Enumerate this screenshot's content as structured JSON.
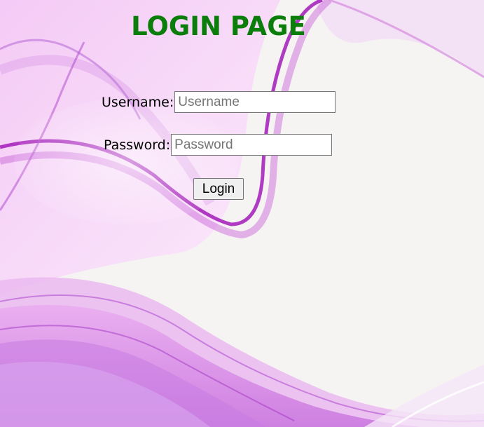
{
  "page": {
    "title": "LOGIN PAGE",
    "title_color": "#0b7d0b",
    "background_accent": "#c23fdc"
  },
  "form": {
    "username_label": "Username:",
    "username_placeholder": "Username",
    "username_value": "",
    "password_label": "Password:",
    "password_placeholder": "Password",
    "password_value": "",
    "login_label": "Login"
  }
}
